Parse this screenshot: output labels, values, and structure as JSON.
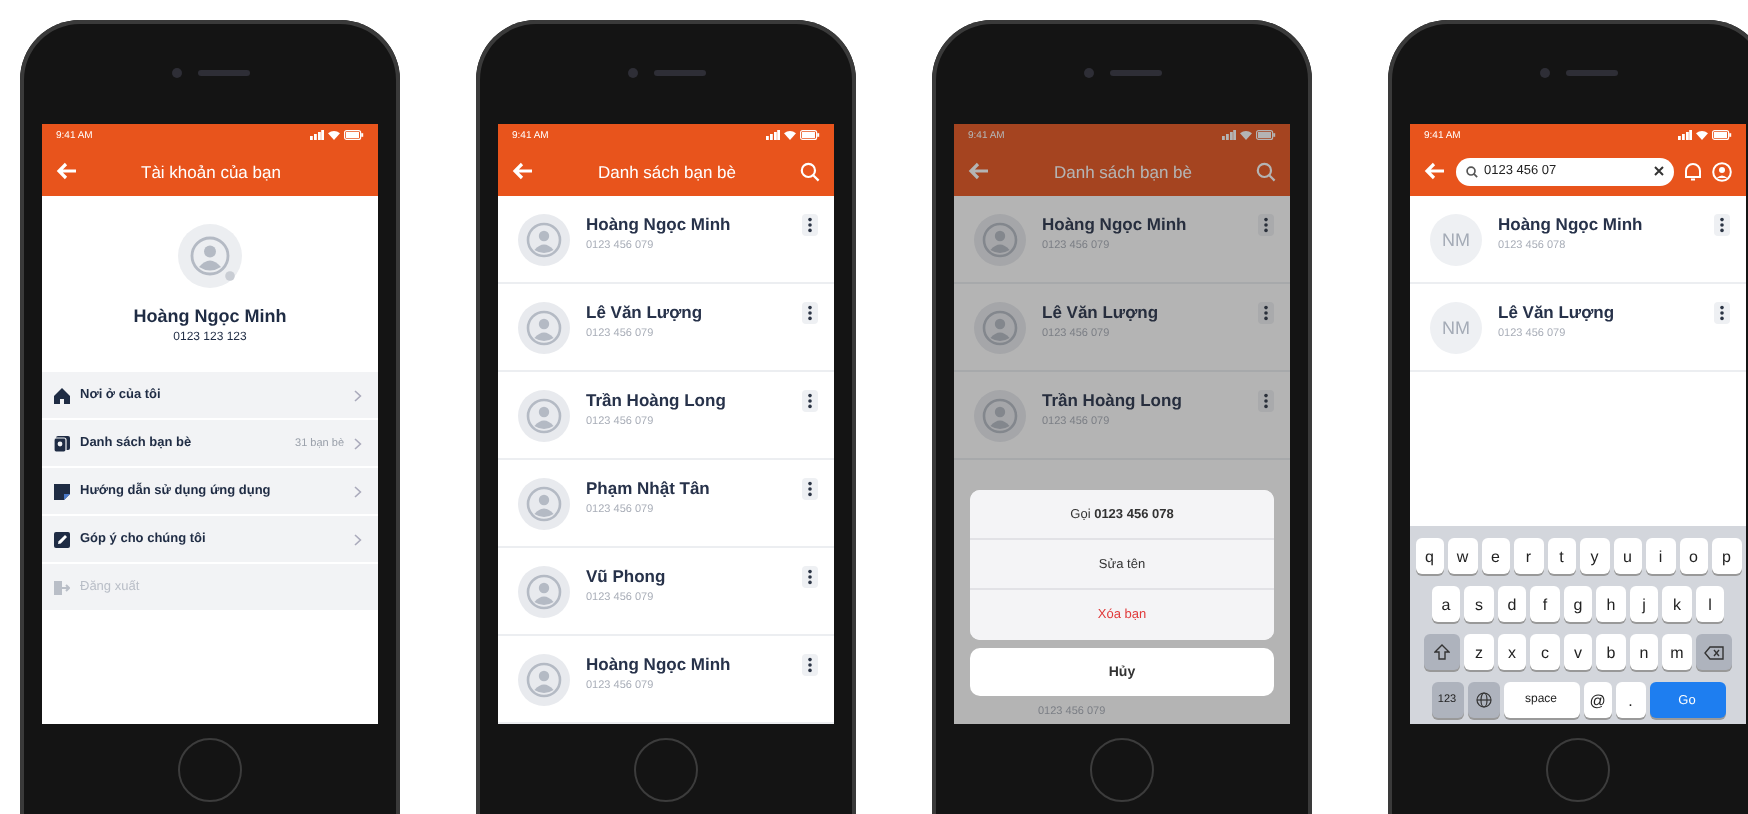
{
  "phones": [
    {
      "kind": "account",
      "time": "9:41 AM",
      "title": "Tài khoản của bạn",
      "profile": {
        "name": "Hoàng Ngọc Minh",
        "phone": "0123 123 123"
      },
      "menu": [
        {
          "kind": "home",
          "label": "Nơi ở của tôi",
          "disabled": false
        },
        {
          "kind": "contacts",
          "label": "Danh sách bạn bè",
          "value": "31 bạn bè",
          "disabled": false
        },
        {
          "kind": "guide",
          "label": "Hướng dẫn sử dụng ứng dụng",
          "disabled": false
        },
        {
          "kind": "feedback",
          "label": "Góp ý cho chúng tôi",
          "disabled": false
        },
        {
          "kind": "logout",
          "label": "Đăng xuất",
          "disabled": true
        }
      ]
    },
    {
      "kind": "list",
      "time": "9:41 AM",
      "title": "Danh sách bạn bè",
      "contacts": [
        {
          "name": "Hoàng Ngọc Minh",
          "phone": "0123 456 079"
        },
        {
          "name": "Lê Văn Lượng",
          "phone": "0123 456 079"
        },
        {
          "name": "Trần Hoàng Long",
          "phone": "0123 456 079"
        },
        {
          "name": "Phạm Nhật Tân",
          "phone": "0123 456 079"
        },
        {
          "name": "Vũ Phong",
          "phone": "0123 456 079"
        },
        {
          "name": "Hoàng Ngọc Minh",
          "phone": "0123 456 079"
        }
      ]
    },
    {
      "kind": "sheet",
      "time": "9:41 AM",
      "title": "Danh sách bạn bè",
      "contacts": [
        {
          "name": "Hoàng Ngọc Minh",
          "phone": "0123 456 079"
        },
        {
          "name": "Lê Văn Lượng",
          "phone": "0123 456 079"
        },
        {
          "name": "Trần Hoàng Long",
          "phone": "0123 456 079"
        }
      ],
      "peek_phone": "0123 456 079",
      "actions": [
        {
          "text": "Gọi **0123 456 078**",
          "kind": "default"
        },
        {
          "text": "Sửa tên",
          "kind": "default"
        },
        {
          "text": "Xóa bạn",
          "kind": "destructive"
        }
      ],
      "cancel": "Hủy"
    },
    {
      "kind": "search",
      "time": "9:41 AM",
      "search": {
        "value": "0123 456 07"
      },
      "contacts": [
        {
          "initials": "NM",
          "name": "Hoàng Ngọc Minh",
          "phone": "0123 456 078"
        },
        {
          "initials": "NM",
          "name": "Lê Văn Lượng",
          "phone": "0123 456 079"
        }
      ],
      "keyboard": {
        "rows": [
          [
            "q",
            "w",
            "e",
            "r",
            "t",
            "y",
            "u",
            "i",
            "o",
            "p"
          ],
          [
            "a",
            "s",
            "d",
            "f",
            "g",
            "h",
            "j",
            "k",
            "l"
          ],
          [
            "z",
            "x",
            "c",
            "v",
            "b",
            "n",
            "m"
          ]
        ],
        "numbers": "123",
        "space": "space",
        "at": "@",
        "dot": ".",
        "go": "Go"
      }
    }
  ]
}
